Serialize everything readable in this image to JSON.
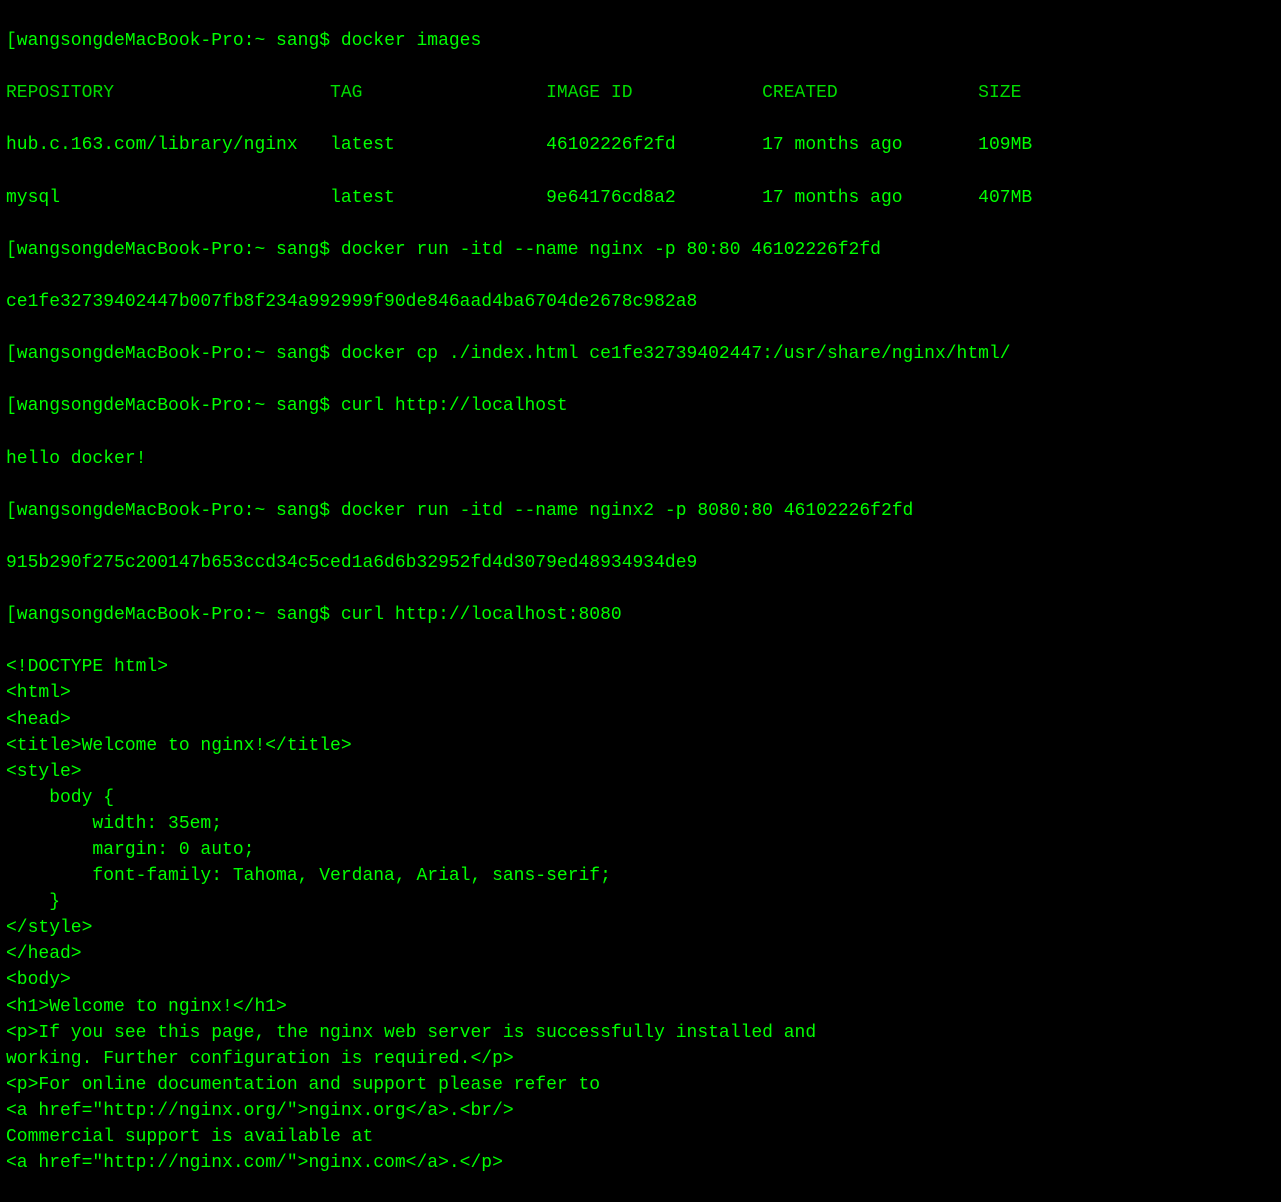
{
  "prompt_prefix": "[wangsongdeMacBook-Pro:~ sang$ ",
  "commands": {
    "cmd1": "docker images",
    "cmd2": "docker run -itd --name nginx -p 80:80 46102226f2fd",
    "cmd3": "docker cp ./index.html ce1fe32739402447:/usr/share/nginx/html/",
    "cmd4": "curl http://localhost",
    "cmd5": "docker run -itd --name nginx2 -p 8080:80 46102226f2fd",
    "cmd6": "curl http://localhost:8080"
  },
  "table_header": {
    "col1": "REPOSITORY",
    "col2": "TAG",
    "col3": "IMAGE ID",
    "col4": "CREATED",
    "col5": "SIZE"
  },
  "table_rows": [
    {
      "repository": "hub.c.163.com/library/nginx",
      "tag": "latest",
      "image_id": "46102226f2fd",
      "created": "17 months ago",
      "size": "109MB"
    },
    {
      "repository": "mysql",
      "tag": "latest",
      "image_id": "9e64176cd8a2",
      "created": "17 months ago",
      "size": "407MB"
    }
  ],
  "output": {
    "container_id1": "ce1fe32739402447b007fb8f234a992999f90de846aad4ba6704de2678c982a8",
    "curl_result1": "hello docker!",
    "container_id2": "915b290f275c200147b653ccd34c5ced1a6d6b32952fd4d3079ed48934934de9",
    "html_lines": [
      "<!DOCTYPE html>",
      "<html>",
      "<head>",
      "<title>Welcome to nginx!</title>",
      "<style>",
      "    body {",
      "        width: 35em;",
      "        margin: 0 auto;",
      "        font-family: Tahoma, Verdana, Arial, sans-serif;",
      "    }",
      "</style>",
      "</head>",
      "<body>",
      "<h1>Welcome to nginx!</h1>",
      "<p>If you see this page, the nginx web server is successfully installed and",
      "working. Further configuration is required.</p>",
      "",
      "<p>For online documentation and support please refer to",
      "<a href=\"http://nginx.org/\">nginx.org</a>.<br/>",
      "Commercial support is available at",
      "<a href=\"http://nginx.com/\">nginx.com</a>.</p>"
    ]
  }
}
